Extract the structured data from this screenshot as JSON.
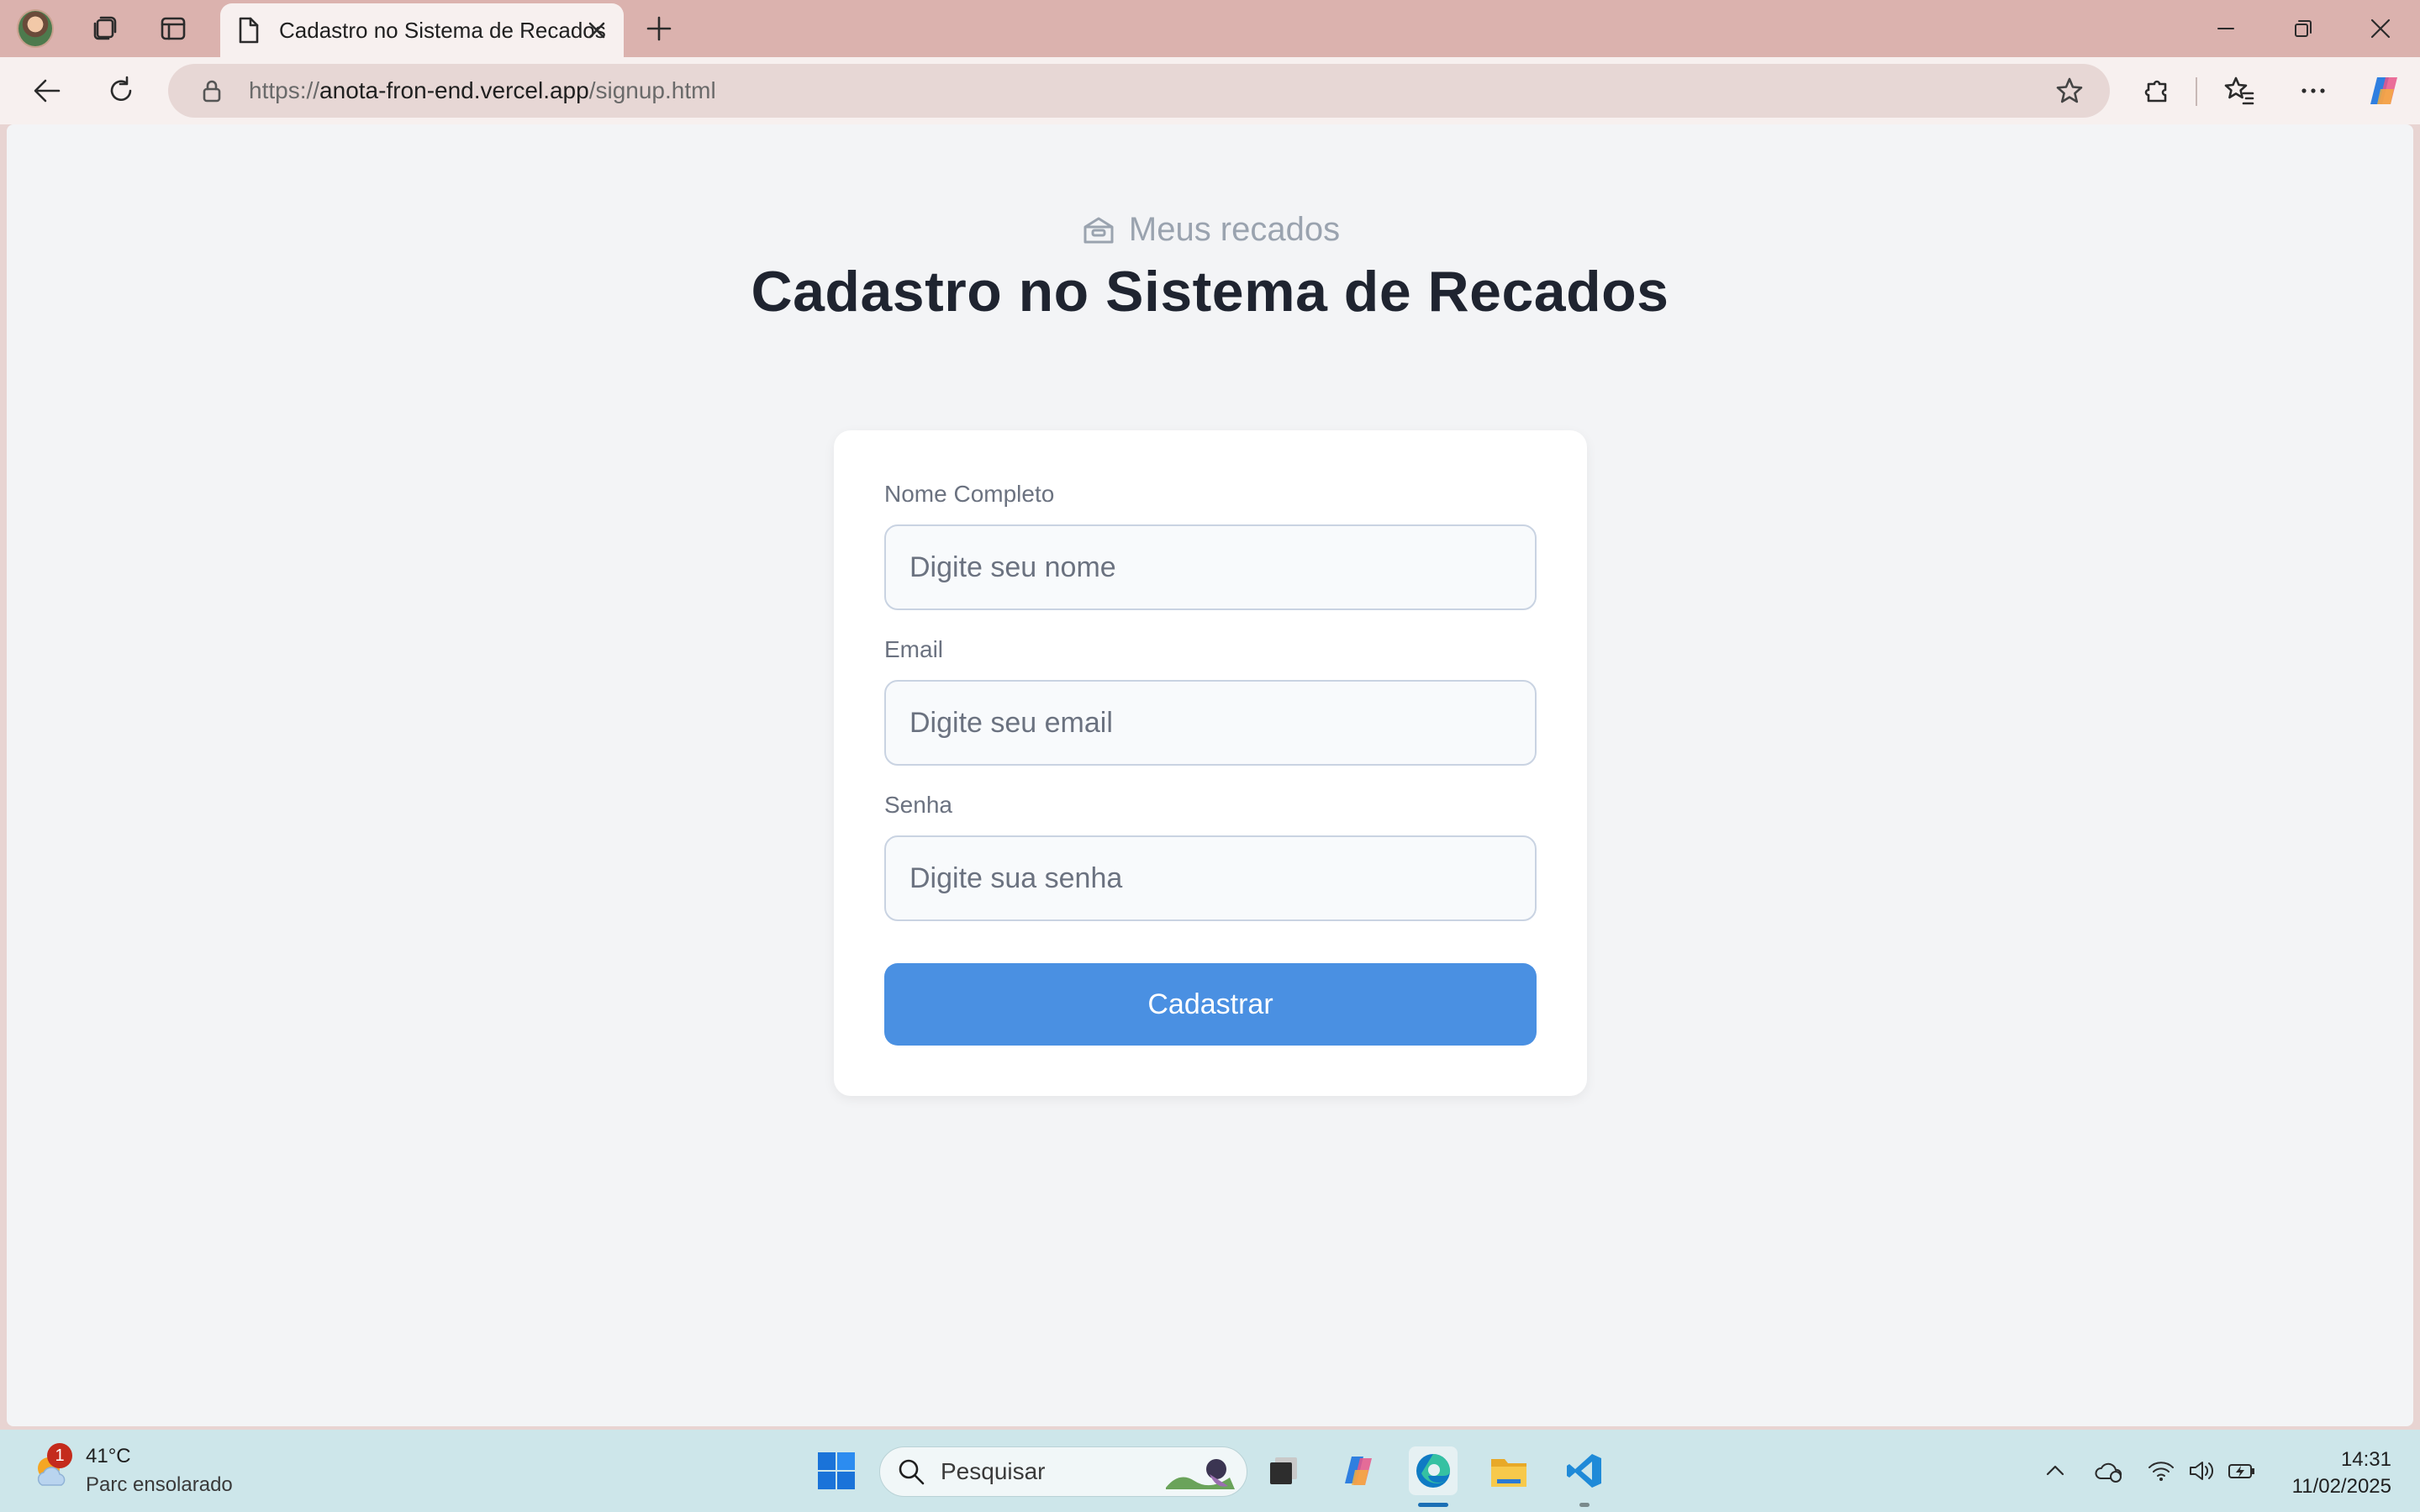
{
  "browser": {
    "tab_title": "Cadastro no Sistema de Recados",
    "url_prefix": "https://",
    "url_host": "anota-fron-end.vercel.app",
    "url_path": "/signup.html"
  },
  "page": {
    "brand_text": "Meus recados",
    "title": "Cadastro no Sistema de Recados",
    "form": {
      "name_label": "Nome Completo",
      "name_placeholder": "Digite seu nome",
      "email_label": "Email",
      "email_placeholder": "Digite seu email",
      "password_label": "Senha",
      "password_placeholder": "Digite sua senha",
      "submit_label": "Cadastrar"
    }
  },
  "taskbar": {
    "weather_badge": "1",
    "weather_temp": "41°C",
    "weather_condition": "Parc ensolarado",
    "search_placeholder": "Pesquisar",
    "time": "14:31",
    "date": "11/02/2025"
  },
  "colors": {
    "titlebar": "#dbb2ae",
    "page_background": "#f3f4f6",
    "primary_button": "#4a90e2",
    "heading_text": "#1f2430",
    "label_text": "#6b7280",
    "taskbar": "#cde6ea"
  },
  "icons": {
    "profile": "avatar",
    "workspaces": "workspaces-icon",
    "vertical_tabs": "vertical-tabs-icon",
    "tab_page": "page-icon",
    "back": "back-arrow-icon",
    "reload": "reload-icon",
    "lock": "lock-icon",
    "favorite": "star-icon",
    "brand": "archive-box-icon",
    "start": "windows-start-icon",
    "search": "search-icon"
  }
}
